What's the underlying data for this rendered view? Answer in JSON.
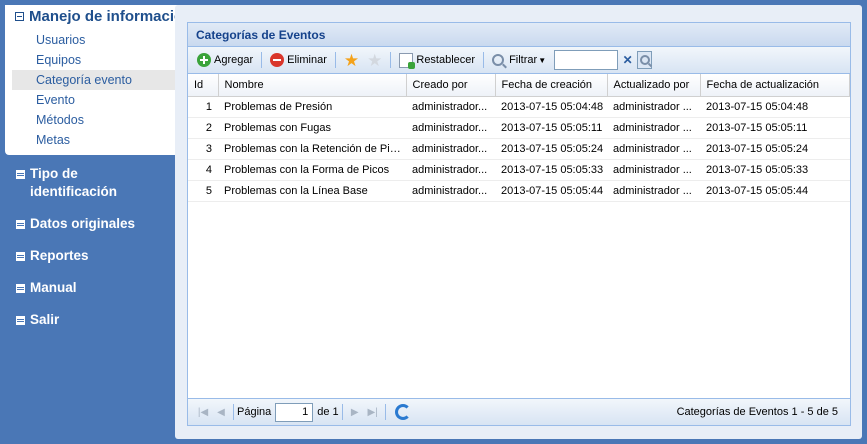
{
  "sidebar": {
    "open_menu": {
      "label": "Manejo de información",
      "items": [
        "Usuarios",
        "Equipos",
        "Categoría evento",
        "Evento",
        "Métodos",
        "Metas"
      ],
      "active_index": 2
    },
    "menus": [
      "Tipo de identificación",
      "Datos originales",
      "Reportes",
      "Manual",
      "Salir"
    ]
  },
  "grid": {
    "title": "Categorías de Eventos",
    "toolbar": {
      "add_label": "Agregar",
      "delete_label": "Eliminar",
      "reset_label": "Restablecer",
      "filter_label": "Filtrar",
      "filter_value": ""
    },
    "columns": [
      "Id",
      "Nombre",
      "Creado por",
      "Fecha de creación",
      "Actualizado por",
      "Fecha de actualización"
    ],
    "rows": [
      [
        "1",
        "Problemas de Presión",
        "administrador...",
        "2013-07-15 05:04:48",
        "administrador ...",
        "2013-07-15 05:04:48"
      ],
      [
        "2",
        "Problemas con Fugas",
        "administrador...",
        "2013-07-15 05:05:11",
        "administrador ...",
        "2013-07-15 05:05:11"
      ],
      [
        "3",
        "Problemas con la Retención de Picos",
        "administrador...",
        "2013-07-15 05:05:24",
        "administrador ...",
        "2013-07-15 05:05:24"
      ],
      [
        "4",
        "Problemas con la Forma de Picos",
        "administrador...",
        "2013-07-15 05:05:33",
        "administrador ...",
        "2013-07-15 05:05:33"
      ],
      [
        "5",
        "Problemas con la Línea Base",
        "administrador...",
        "2013-07-15 05:05:44",
        "administrador ...",
        "2013-07-15 05:05:44"
      ]
    ],
    "pager": {
      "page_label": "Página",
      "page_value": "1",
      "of_label": "de 1",
      "info": "Categorías de Eventos 1 - 5 de 5"
    }
  },
  "colors": {
    "background": "#4a77b6",
    "header_blue": "#15428b",
    "link_blue": "#2b5da0"
  }
}
